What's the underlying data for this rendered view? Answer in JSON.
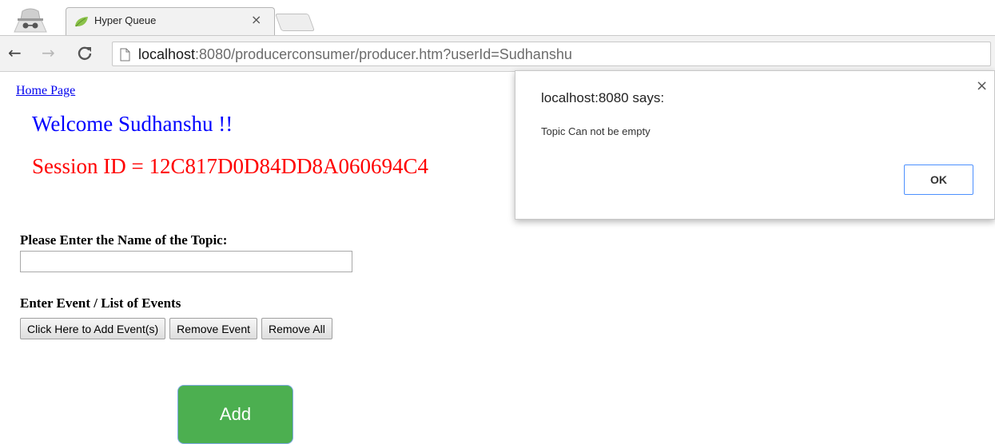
{
  "browser": {
    "tab_title": "Hyper Queue",
    "tab_close": "×",
    "url_host": "localhost",
    "url_rest": ":8080/producerconsumer/producer.htm?userId=Sudhanshu",
    "icons": {
      "back": "back-arrow-icon",
      "forward": "forward-arrow-icon",
      "reload": "reload-icon",
      "page": "page-icon",
      "incognito": "incognito-icon",
      "favicon": "leaf-favicon-icon"
    }
  },
  "page": {
    "home_link": "Home Page",
    "welcome": "Welcome Sudhanshu !!",
    "session": "Session ID = 12C817D0D84DD8A060694C4",
    "topic_label": "Please Enter the Name of the Topic:",
    "topic_value": "",
    "events_label": "Enter Event / List of Events",
    "buttons": {
      "add_events": "Click Here to Add Event(s)",
      "remove_event": "Remove Event",
      "remove_all": "Remove All",
      "add": "Add"
    },
    "colors": {
      "welcome": "#0000ff",
      "session": "#ff0000",
      "add_button": "#4caf50"
    }
  },
  "dialog": {
    "title": "localhost:8080 says:",
    "message": "Topic Can not be empty",
    "ok": "OK",
    "close": "×"
  }
}
